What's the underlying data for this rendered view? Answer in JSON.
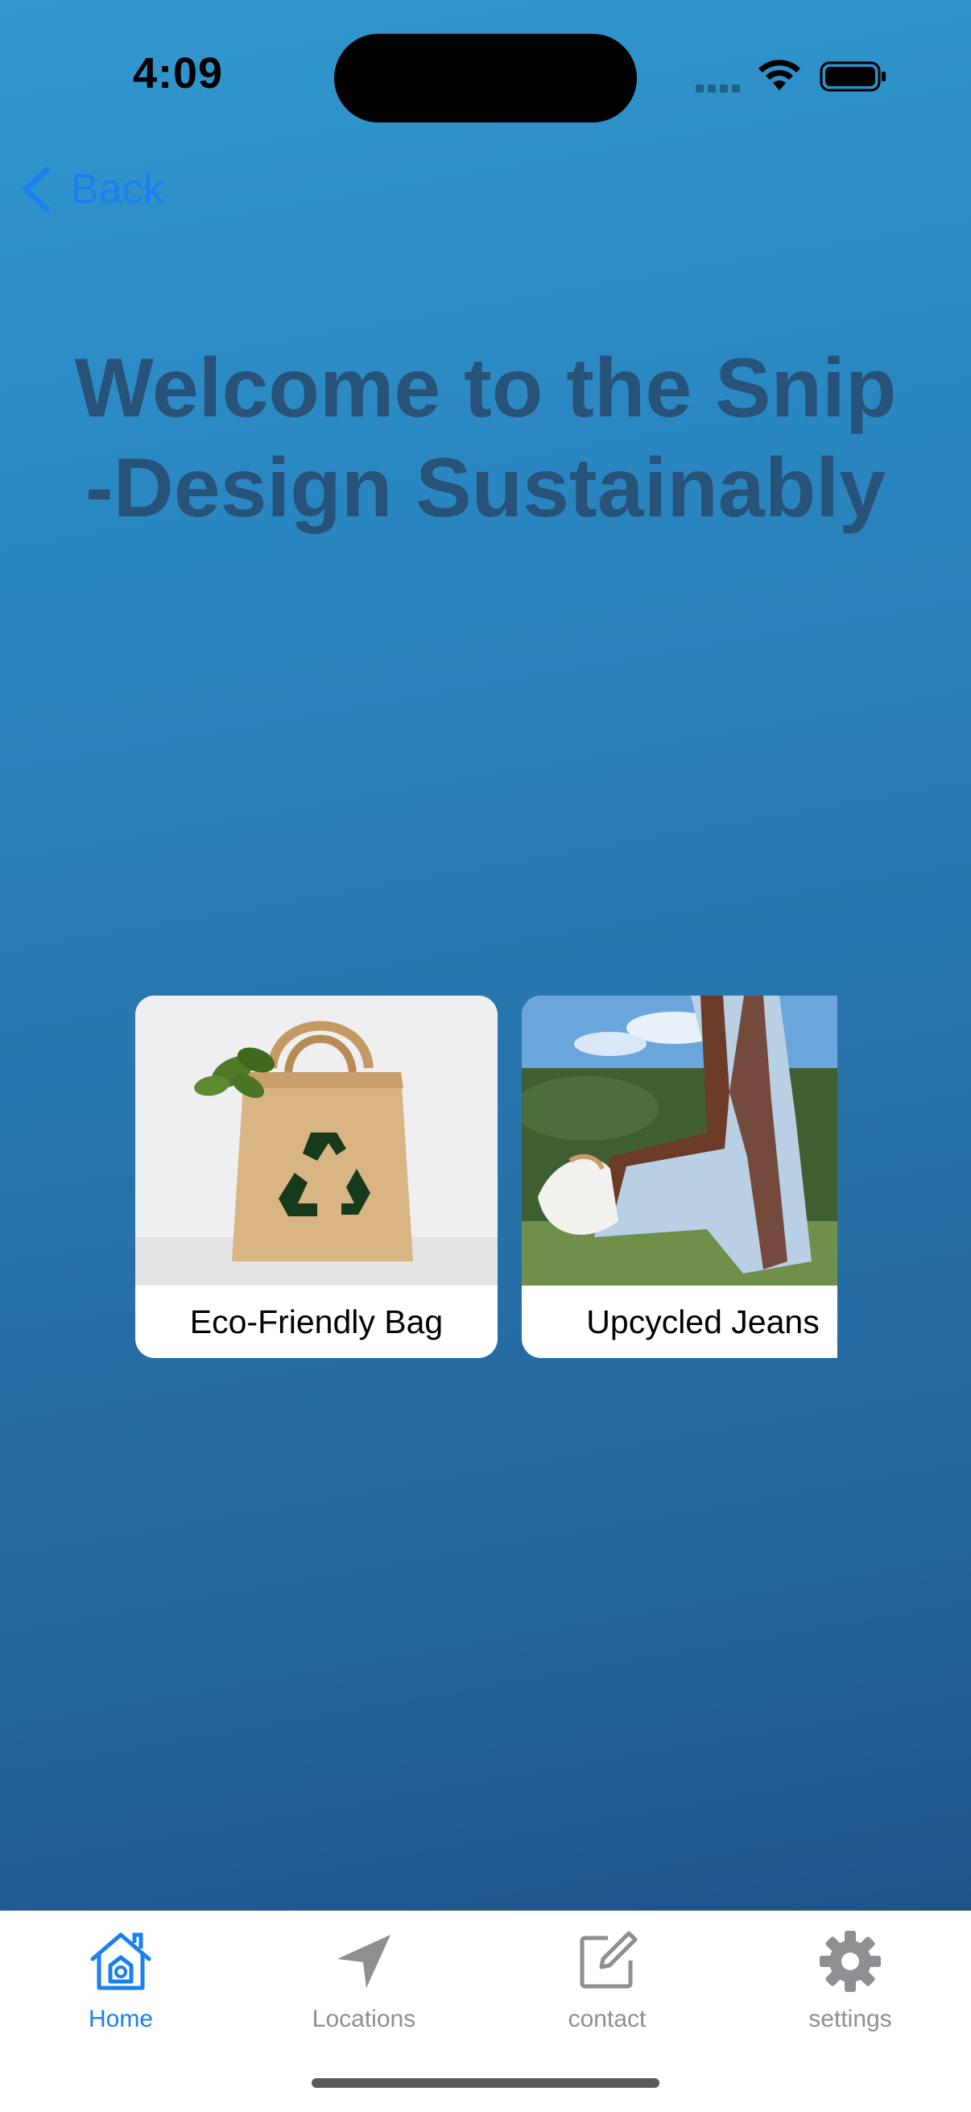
{
  "status_bar": {
    "time": "4:09"
  },
  "nav": {
    "back_label": "Back"
  },
  "headline": {
    "line1": "Welcome to the Snip",
    "line2": "-Design Sustainably"
  },
  "products": [
    {
      "label": "Eco-Friendly Bag",
      "image": "tote-bag-recycle-photo"
    },
    {
      "label": "Upcycled Jeans",
      "image": "patterned-jeans-photo"
    }
  ],
  "tabs": [
    {
      "label": "Home",
      "icon": "house-icon",
      "active": true
    },
    {
      "label": "Locations",
      "icon": "location-arrow-icon",
      "active": false
    },
    {
      "label": "contact",
      "icon": "compose-icon",
      "active": false
    },
    {
      "label": "settings",
      "icon": "gear-icon",
      "active": false
    }
  ],
  "colors": {
    "accent": "#1a7ff0",
    "headline": "#27527a",
    "inactive_tab": "#8e8e93",
    "gradient_top": "#3297cf",
    "gradient_bottom": "#1d4b82"
  }
}
